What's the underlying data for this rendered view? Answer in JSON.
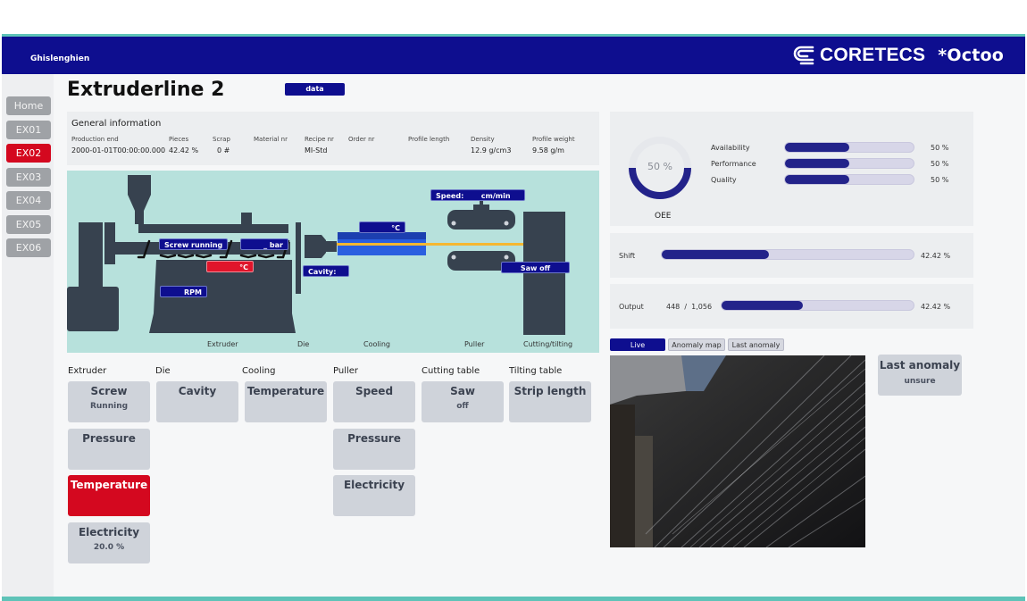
{
  "header": {
    "site": "Ghislenghien",
    "brand": "CORETECS",
    "brand2": "*Octoo"
  },
  "sidebar": {
    "items": [
      {
        "label": "Home",
        "active": false
      },
      {
        "label": "EX01",
        "active": false
      },
      {
        "label": "EX02",
        "active": true
      },
      {
        "label": "EX03",
        "active": false
      },
      {
        "label": "EX04",
        "active": false
      },
      {
        "label": "EX05",
        "active": false
      },
      {
        "label": "EX06",
        "active": false
      }
    ]
  },
  "page": {
    "title": "Extruderline 2",
    "data_button": "data"
  },
  "general_info": {
    "heading": "General information",
    "fields": [
      {
        "label": "Production end",
        "value": "2000-01-01T00:00:00.000"
      },
      {
        "label": "Pieces",
        "value": "42.42  %"
      },
      {
        "label": "Scrap",
        "value": "0  #"
      },
      {
        "label": "Material nr",
        "value": ""
      },
      {
        "label": "Recipe nr",
        "value": "MI-Std"
      },
      {
        "label": "Order nr",
        "value": ""
      },
      {
        "label": "Profile length",
        "value": ""
      },
      {
        "label": "Density",
        "value": "12.9  g/cm3"
      },
      {
        "label": "Profile weight",
        "value": "9.58  g/m"
      }
    ]
  },
  "diagram": {
    "labels": {
      "screw": "Screw running",
      "pressure": "_ bar",
      "temperature": "°C",
      "rpm": "RPM",
      "cavity": "Cavity:",
      "cooling_temp": "°C",
      "speed": "Speed:       cm/min",
      "saw": "Saw off"
    },
    "sections": [
      "Extruder",
      "Die",
      "Cooling",
      "Puller",
      "Cutting/tilting"
    ],
    "colors": {
      "background": "#b7e1dc",
      "machine": "#37424f",
      "label": "#0e0e8f",
      "alarm": "#e0152b",
      "profile": "#f5b731",
      "cooling": "#2a5fe0"
    }
  },
  "groups": [
    {
      "title": "Extruder",
      "tiles": [
        {
          "title": "Screw",
          "sub": "Running",
          "alarm": false
        },
        {
          "title": "Pressure",
          "sub": "",
          "alarm": false
        },
        {
          "title": "Temperature",
          "sub": "",
          "alarm": true
        },
        {
          "title": "Electricity",
          "sub": "20.0 %",
          "alarm": false
        }
      ]
    },
    {
      "title": "Die",
      "tiles": [
        {
          "title": "Cavity",
          "sub": "",
          "alarm": false
        }
      ]
    },
    {
      "title": "Cooling",
      "tiles": [
        {
          "title": "Temperature",
          "sub": "",
          "alarm": false
        }
      ]
    },
    {
      "title": "Puller",
      "tiles": [
        {
          "title": "Speed",
          "sub": "",
          "alarm": false
        },
        {
          "title": "Pressure",
          "sub": "",
          "alarm": false
        },
        {
          "title": "Electricity",
          "sub": "",
          "alarm": false
        }
      ]
    },
    {
      "title": "Cutting table",
      "tiles": [
        {
          "title": "Saw",
          "sub": "off",
          "alarm": false
        }
      ]
    },
    {
      "title": "Tilting table",
      "tiles": [
        {
          "title": "Strip length",
          "sub": "",
          "alarm": false
        }
      ]
    }
  ],
  "oee": {
    "label": "OEE",
    "value_text": "50 %",
    "value": 50,
    "metrics": [
      {
        "label": "Availability",
        "value": 50,
        "text": "50  %"
      },
      {
        "label": "Performance",
        "value": 50,
        "text": "50  %"
      },
      {
        "label": "Quality",
        "value": 50,
        "text": "50  %"
      }
    ]
  },
  "shift": {
    "label": "Shift",
    "value": 42.42,
    "text": "42.42  %"
  },
  "output": {
    "label": "Output",
    "count": "448  /  1,056",
    "value": 42.42,
    "text": "42.42  %"
  },
  "camera_tabs": [
    {
      "label": "Live",
      "active": true
    },
    {
      "label": "Anomaly map",
      "active": false
    },
    {
      "label": "Last anomaly",
      "active": false
    }
  ],
  "last_anomaly": {
    "title": "Last anomaly",
    "value": "unsure"
  },
  "colors": {
    "primary": "#0e0e8f",
    "alarm": "#d4081f",
    "accent": "#5ec3b8"
  }
}
